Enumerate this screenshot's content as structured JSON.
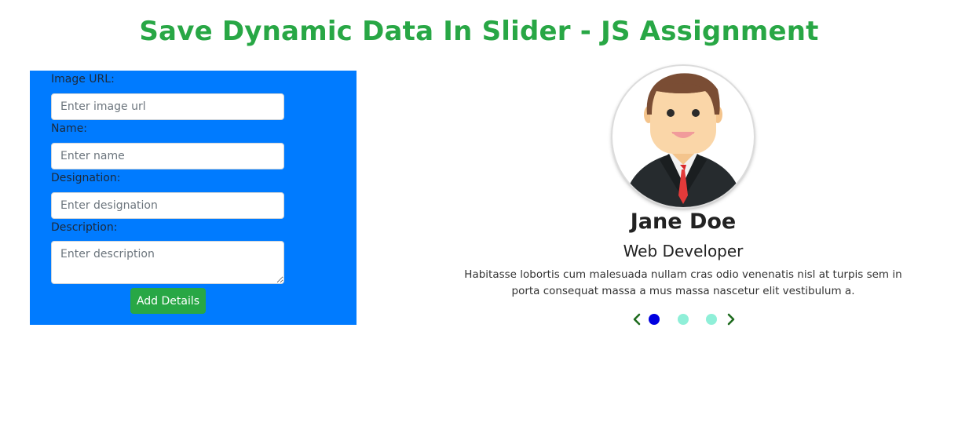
{
  "page": {
    "title": "Save Dynamic Data In Slider - JS Assignment"
  },
  "form": {
    "image_url_label": "Image URL:",
    "image_url_placeholder": "Enter image url",
    "name_label": "Name:",
    "name_placeholder": "Enter name",
    "designation_label": "Designation:",
    "designation_placeholder": "Enter designation",
    "description_label": "Description:",
    "description_placeholder": "Enter description",
    "submit_label": "Add Details"
  },
  "slider": {
    "name": "Jane Doe",
    "designation": "Web Developer",
    "description": "Habitasse lobortis cum malesuada nullam cras odio venenatis nisl at turpis sem in porta consequat massa a mus massa nascetur elit vestibulum a.",
    "slide_count": 3,
    "active_index": 0,
    "icons": {
      "prev": "chevron-left-icon",
      "next": "chevron-right-icon",
      "avatar": "person-avatar-icon"
    }
  },
  "colors": {
    "title": "#28a745",
    "panel": "#007bff",
    "button": "#28a745",
    "dot_active": "#0000e0",
    "dot_inactive": "#8fefd8",
    "arrow": "#1e6b1e"
  }
}
